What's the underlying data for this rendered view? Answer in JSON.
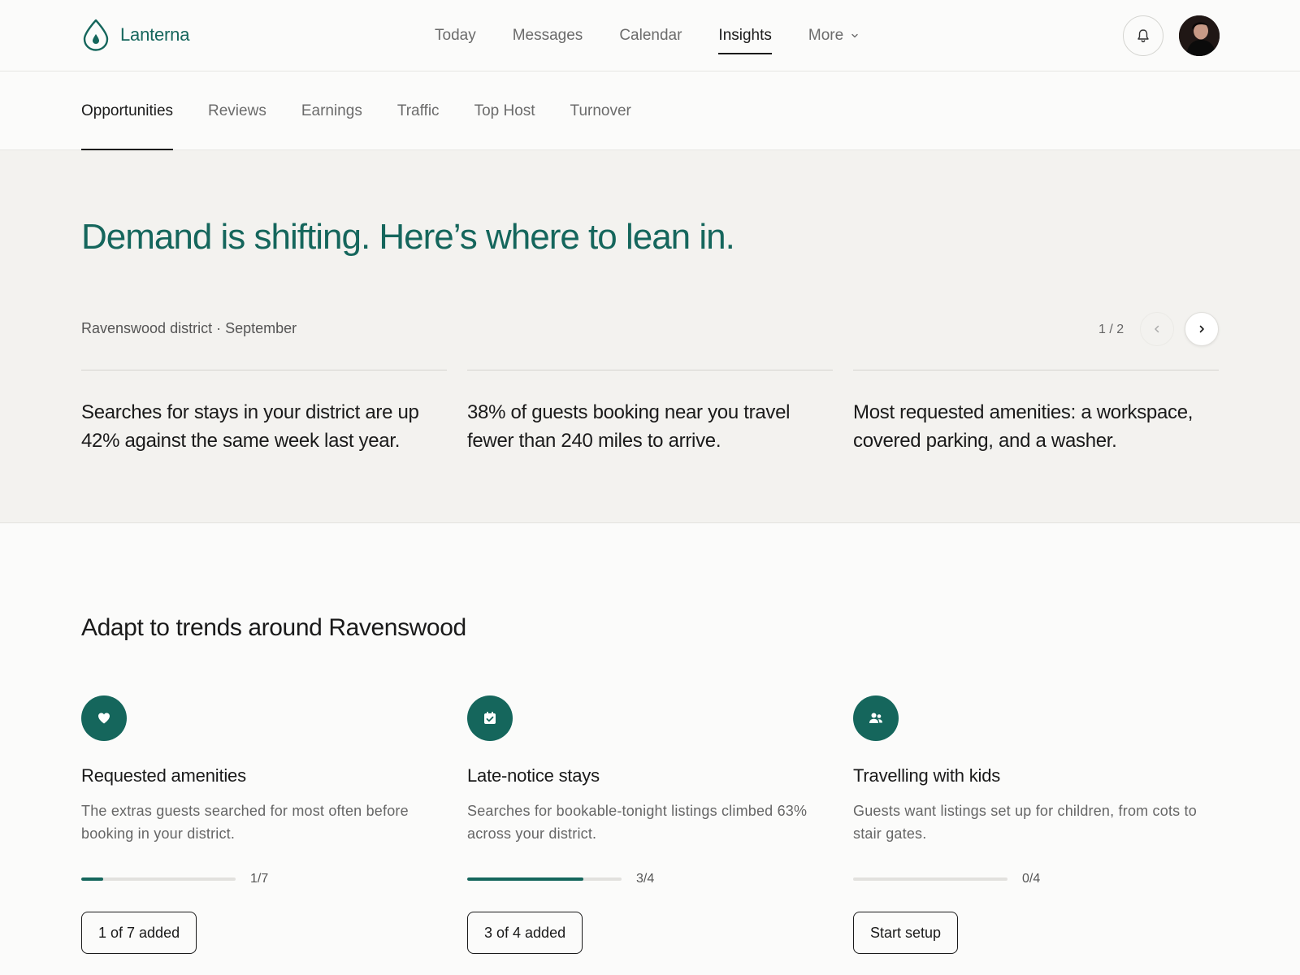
{
  "app": {
    "brand": "Lanterna",
    "brand_color": "#15665c"
  },
  "nav": {
    "items": [
      {
        "label": "Today",
        "active": false
      },
      {
        "label": "Messages",
        "active": false
      },
      {
        "label": "Calendar",
        "active": false
      },
      {
        "label": "Insights",
        "active": true
      },
      {
        "label": "More",
        "active": false
      }
    ],
    "icons": {
      "notifications": "bell-icon",
      "more": "chevron-down-icon"
    }
  },
  "tabs": [
    {
      "label": "Opportunities",
      "active": true
    },
    {
      "label": "Reviews",
      "active": false
    },
    {
      "label": "Earnings",
      "active": false
    },
    {
      "label": "Traffic",
      "active": false
    },
    {
      "label": "Top Host",
      "active": false
    },
    {
      "label": "Turnover",
      "active": false
    }
  ],
  "hero": {
    "title": "Demand is shifting. Here’s where to lean in.",
    "meta": "Ravenswood district · September",
    "pager": "1 / 2",
    "facts": [
      "Searches for stays in your district are up 42% against the same week last year.",
      "38% of guests booking near you travel fewer than 240 miles to arrive.",
      "Most requested amenities: a workspace, covered parking, and a washer."
    ]
  },
  "trends": {
    "title": "Adapt to trends around Ravenswood",
    "cards": [
      {
        "icon": "heart-icon",
        "title": "Requested amenities",
        "description": "The extras guests searched for most often before booking in your district.",
        "progress_text": "1/7",
        "progress": 0.1429,
        "button": "1 of 7 added"
      },
      {
        "icon": "calendar-check-icon",
        "title": "Late-notice stays",
        "description": "Searches for bookable-tonight listings climbed 63% across your district.",
        "progress_text": "3/4",
        "progress": 0.75,
        "button": "3 of 4 added"
      },
      {
        "icon": "people-icon",
        "title": "Travelling with kids",
        "description": "Guests want listings set up for children, from cots to stair gates.",
        "progress_text": "0/4",
        "progress": 0,
        "button": "Start setup"
      }
    ]
  }
}
